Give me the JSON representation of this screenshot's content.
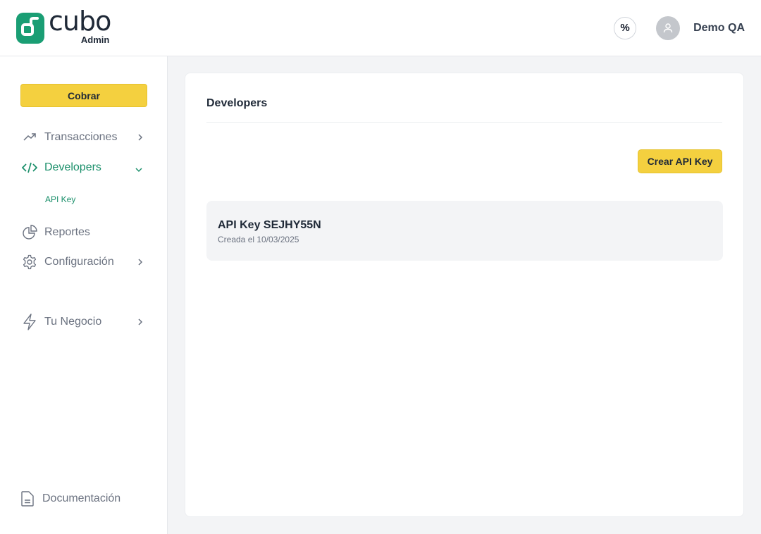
{
  "header": {
    "logo_word": "cubo",
    "logo_sub": "Admin",
    "percent_symbol": "%",
    "user_name": "Demo QA"
  },
  "sidebar": {
    "cobrar_label": "Cobrar",
    "items": [
      {
        "label": "Transacciones",
        "icon": "trending-up-icon"
      },
      {
        "label": "Developers",
        "icon": "code-icon",
        "active": true
      },
      {
        "label": "Reportes",
        "icon": "pie-chart-icon"
      },
      {
        "label": "Configuración",
        "icon": "gear-icon"
      },
      {
        "label": "Tu Negocio",
        "icon": "lightning-icon"
      }
    ],
    "sub_item": "API Key",
    "documentation_label": "Documentación"
  },
  "main": {
    "title": "Developers",
    "create_label": "Crear API Key",
    "api_keys": [
      {
        "name": "API Key SEJHY55N",
        "created": "Creada el 10/03/2025"
      }
    ]
  },
  "colors": {
    "brand_green": "#1a9e74",
    "accent_yellow": "#f4d03f"
  }
}
